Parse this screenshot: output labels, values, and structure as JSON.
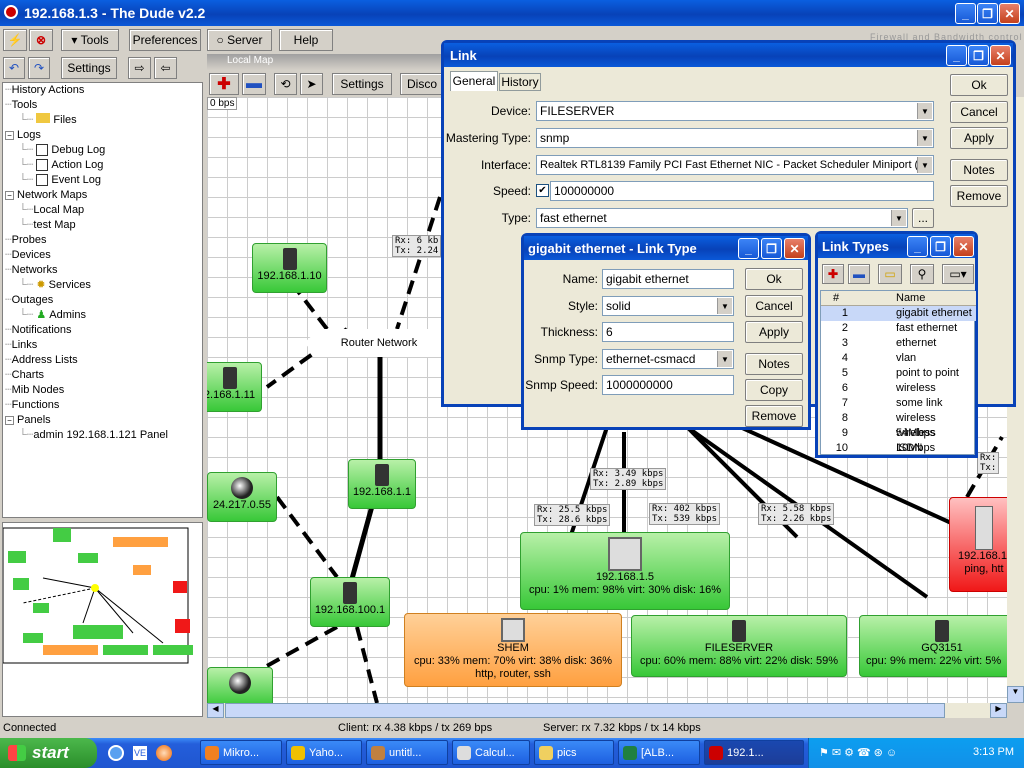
{
  "app": {
    "title": "192.168.1.3 - The Dude v2.2",
    "brand_tag": "Firewall and Bandwidth control"
  },
  "toolbar": {
    "tools": "Tools",
    "preferences": "Preferences",
    "server": "Server",
    "help": "Help",
    "settings": "Settings"
  },
  "tree": [
    {
      "label": "History Actions"
    },
    {
      "label": "Tools"
    },
    {
      "label": "Files"
    },
    {
      "label": "Logs"
    },
    {
      "label": "Debug Log"
    },
    {
      "label": "Action Log"
    },
    {
      "label": "Event Log"
    },
    {
      "label": "Network Maps"
    },
    {
      "label": "Local Map"
    },
    {
      "label": "test Map"
    },
    {
      "label": "Probes"
    },
    {
      "label": "Devices"
    },
    {
      "label": "Networks"
    },
    {
      "label": "Services"
    },
    {
      "label": "Outages"
    },
    {
      "label": "Admins"
    },
    {
      "label": "Notifications"
    },
    {
      "label": "Links"
    },
    {
      "label": "Address Lists"
    },
    {
      "label": "Charts"
    },
    {
      "label": "Mib Nodes"
    },
    {
      "label": "Functions"
    },
    {
      "label": "Panels"
    },
    {
      "label": "admin 192.168.1.121 Panel"
    }
  ],
  "map": {
    "tab": "Local Map",
    "settings": "Settings",
    "discover": "Disco",
    "rate_label": "0 bps",
    "router_network": "Router Network",
    "nodes": {
      "n10": "192.168.1.10",
      "n11": "2.168.1.11",
      "n1": "192.168.1.1",
      "n24": "24.217.0.55",
      "n100": "192.168.100.1",
      "n5_name": "192.168.1.5",
      "n5_stats": "cpu: 1% mem: 98% virt: 30% disk: 16%",
      "shem_name": "SHEM",
      "shem_stats": "cpu: 33% mem: 70% virt: 38% disk: 36%",
      "shem_services": "http, router, ssh",
      "fs_name": "FILESERVER",
      "fs_stats": "cpu: 60% mem: 88% virt: 22% disk: 59%",
      "gq_name": "GQ3151",
      "gq_stats": "cpu: 9% mem: 22% virt: 5%",
      "red_name": "192.168.1.",
      "red_stats": "ping, htt"
    },
    "rates": {
      "r1": "Rx: 6 kb\nTx: 2.24",
      "r2": "Rx: 3.49 kbps\nTx: 2.89 kbps",
      "r3": "Rx: 25.5 kbps\nTx: 28.6 kbps",
      "r4": "Rx: 402 kbps\nTx: 539 kbps",
      "r5": "Rx: 5.58 kbps\nTx: 2.26 kbps",
      "r6": "Rx:\nTx:"
    }
  },
  "link_dialog": {
    "title": "Link",
    "tabs": [
      "General",
      "History"
    ],
    "device_label": "Device:",
    "device": "FILESERVER",
    "mastering_label": "Mastering Type:",
    "mastering": "snmp",
    "interface_label": "Interface:",
    "interface": "Realtek RTL8139 Family PCI Fast Ethernet NIC - Packet Scheduler Miniport  (2)",
    "speed_label": "Speed:",
    "speed": "100000000",
    "type_label": "Type:",
    "type": "fast ethernet",
    "buttons": {
      "ok": "Ok",
      "cancel": "Cancel",
      "apply": "Apply",
      "notes": "Notes",
      "remove": "Remove"
    },
    "more": "..."
  },
  "linktype_dialog": {
    "title": "gigabit ethernet - Link Type",
    "name_label": "Name:",
    "name": "gigabit ethernet",
    "style_label": "Style:",
    "style": "solid",
    "thickness_label": "Thickness:",
    "thickness": "6",
    "snmptype_label": "Snmp Type:",
    "snmptype": "ethernet-csmacd",
    "snmpspeed_label": "Snmp Speed:",
    "snmpspeed": "1000000000",
    "buttons": {
      "ok": "Ok",
      "cancel": "Cancel",
      "apply": "Apply",
      "notes": "Notes",
      "copy": "Copy",
      "remove": "Remove"
    }
  },
  "linktypes_dialog": {
    "title": "Link Types",
    "col_num": "#",
    "col_name": "Name",
    "rows": [
      {
        "n": "1",
        "name": "gigabit ethernet"
      },
      {
        "n": "2",
        "name": "fast ethernet"
      },
      {
        "n": "3",
        "name": "ethernet"
      },
      {
        "n": "4",
        "name": "vlan"
      },
      {
        "n": "5",
        "name": "point to point"
      },
      {
        "n": "6",
        "name": "wireless"
      },
      {
        "n": "7",
        "name": "some link"
      },
      {
        "n": "8",
        "name": "wireless 54Mbps"
      },
      {
        "n": "9",
        "name": "wireless 10Mbps"
      },
      {
        "n": "10",
        "name": "ISDN"
      }
    ]
  },
  "status": {
    "connected": "Connected",
    "client": "Client: rx 4.38 kbps / tx 269 bps",
    "server": "Server: rx 7.32 kbps / tx 14 kbps"
  },
  "taskbar": {
    "start": "start",
    "items": [
      "Mikro...",
      "Yaho...",
      "untitl...",
      "Calcul...",
      "pics",
      "[ALB...",
      "192.1..."
    ],
    "clock": "3:13 PM"
  }
}
